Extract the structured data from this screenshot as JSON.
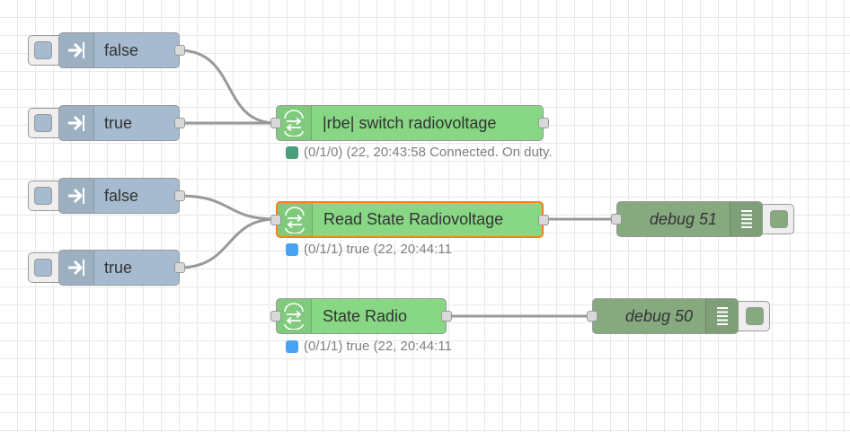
{
  "flow": {
    "injects": [
      {
        "label": "false"
      },
      {
        "label": "true"
      },
      {
        "label": "false"
      },
      {
        "label": "true"
      }
    ],
    "knx_nodes": [
      {
        "label": "|rbe| switch radiovoltage",
        "status": "(0/1/0) (22, 20:43:58 Connected. On duty.",
        "status_color": "#4a9e7a"
      },
      {
        "label": "Read State Radiovoltage",
        "status": "(0/1/1) true (22, 20:44:11",
        "status_color": "#4aa3f0"
      },
      {
        "label": "State Radio",
        "status": "(0/1/1) true (22, 20:44:11",
        "status_color": "#4aa3f0"
      }
    ],
    "debug_nodes": [
      {
        "label": "debug 51"
      },
      {
        "label": "debug 50"
      }
    ]
  },
  "colors": {
    "inject": "#a6bbcf",
    "knx": "#87d784",
    "debug": "#87a980",
    "selected_border": "#ff7f0e",
    "wire": "#999999"
  },
  "icons": {
    "inject": "arrow-in-icon",
    "knx": "knx-logo-icon",
    "debug": "list-lines-icon"
  }
}
